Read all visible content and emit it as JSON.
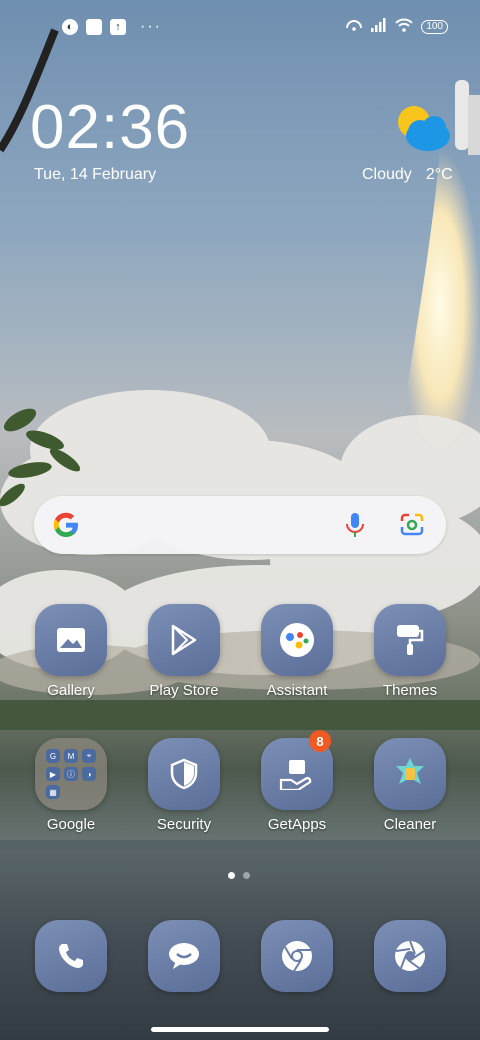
{
  "status_bar": {
    "left_icons": [
      "notification-app-icon",
      "square-notification-icon",
      "upload-notification-icon"
    ],
    "more": "···",
    "right_icons": [
      "hotspot-icon",
      "signal-icon",
      "wifi-icon"
    ],
    "battery": "100"
  },
  "clock": {
    "time": "02:36",
    "date": "Tue, 14 February"
  },
  "weather": {
    "condition": "Cloudy",
    "temperature": "2°C",
    "icon": "partly-cloudy-icon"
  },
  "search": {
    "g_logo": "google-logo-icon",
    "mic": "mic-icon",
    "lens": "lens-icon"
  },
  "apps": [
    {
      "label": "Gallery",
      "icon": "gallery-icon"
    },
    {
      "label": "Play Store",
      "icon": "play-store-icon"
    },
    {
      "label": "Assistant",
      "icon": "assistant-icon"
    },
    {
      "label": "Themes",
      "icon": "themes-paint-roller-icon"
    },
    {
      "label": "Google",
      "icon": "folder-icon",
      "folder_items": [
        "G",
        "M",
        "⌖",
        "▶",
        "ⓘ",
        "◑",
        "▦"
      ]
    },
    {
      "label": "Security",
      "icon": "shield-icon"
    },
    {
      "label": "GetApps",
      "icon": "getapps-icon",
      "badge": "8"
    },
    {
      "label": "Cleaner",
      "icon": "cleaner-icon"
    }
  ],
  "dock": [
    {
      "name": "phone",
      "icon": "phone-icon"
    },
    {
      "name": "messaging",
      "icon": "message-icon"
    },
    {
      "name": "chrome",
      "icon": "chrome-icon"
    },
    {
      "name": "camera",
      "icon": "camera-aperture-icon"
    }
  ],
  "page_indicator": {
    "total": 2,
    "current": 1
  },
  "colors": {
    "search_bg": "#f5f5f7",
    "badge": "#f05a22",
    "icon_tile": "#6a7ea8"
  }
}
